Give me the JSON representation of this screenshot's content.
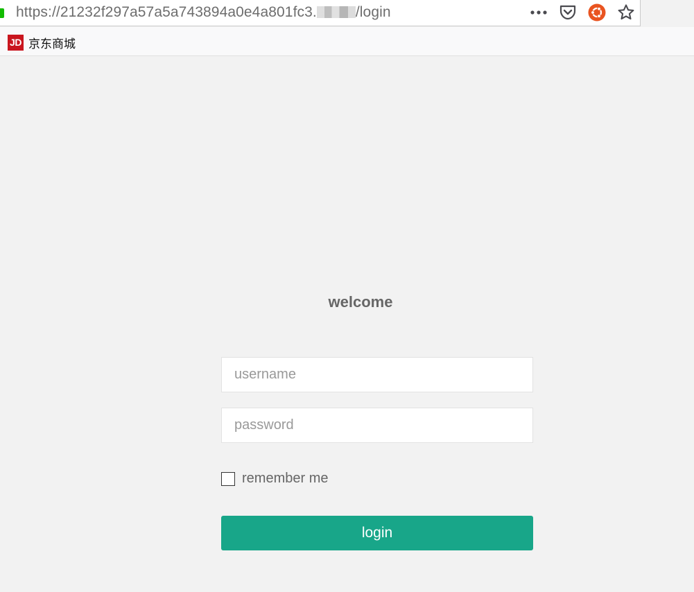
{
  "browser": {
    "url_prefix": "https://21232f297a57a5a743894a0e4a801fc3.",
    "url_redacted": "",
    "url_suffix": "/login",
    "toolbar_icons": [
      "more-actions-icon",
      "pocket-icon",
      "ubuntu-icon",
      "bookmark-star-icon"
    ],
    "bookmarks": [
      {
        "favicon_text": "JD",
        "label": "京东商城",
        "favicon_color": "#c9151e"
      }
    ]
  },
  "login": {
    "title": "welcome",
    "username_placeholder": "username",
    "password_placeholder": "password",
    "remember_label": "remember me",
    "remember_checked": false,
    "submit_label": "login"
  },
  "colors": {
    "accent": "#18a689",
    "background": "#f2f2f2",
    "secure_indicator": "#12bc00"
  }
}
